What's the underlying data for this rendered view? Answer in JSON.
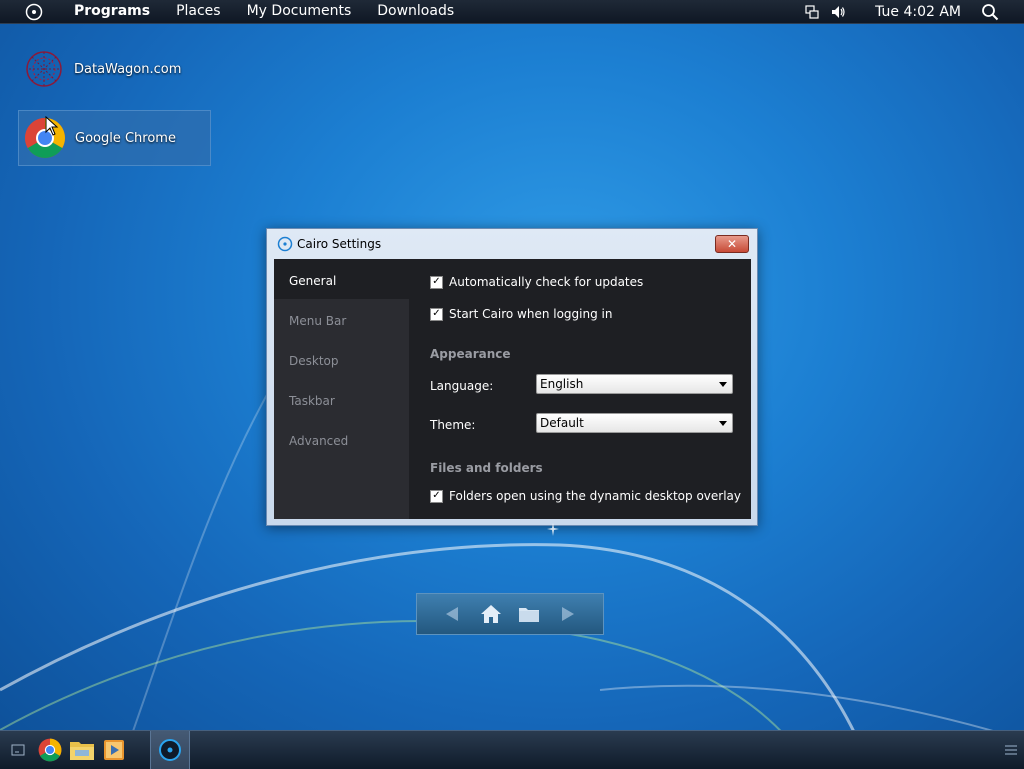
{
  "menubar": {
    "logo_icon": "cairo-logo-icon",
    "items": [
      {
        "label": "Programs"
      },
      {
        "label": "Places"
      },
      {
        "label": "My Documents"
      },
      {
        "label": "Downloads"
      }
    ],
    "clock": "Tue 4:02 AM"
  },
  "desktop": {
    "icons": [
      {
        "label": "DataWagon.com",
        "icon": "datawagon-icon"
      },
      {
        "label": "Google Chrome",
        "icon": "chrome-icon",
        "selected": true
      }
    ]
  },
  "window": {
    "title": "Cairo Settings",
    "nav": [
      {
        "label": "General",
        "active": true
      },
      {
        "label": "Menu Bar"
      },
      {
        "label": "Desktop"
      },
      {
        "label": "Taskbar"
      },
      {
        "label": "Advanced"
      }
    ],
    "general": {
      "auto_update": {
        "label": "Automatically check for updates",
        "checked": true
      },
      "start_login": {
        "label": "Start Cairo when logging in",
        "checked": true
      },
      "appearance_heading": "Appearance",
      "language_label": "Language:",
      "language_value": "English",
      "theme_label": "Theme:",
      "theme_value": "Default",
      "files_heading": "Files and folders",
      "folders_overlay": {
        "label": "Folders open using the dynamic desktop overlay",
        "checked": true
      }
    }
  },
  "colors": {
    "accent": "#1c7fd2",
    "menubar": "#1f2937",
    "window_content": "#1e1f23",
    "close_button": "#c74a36"
  }
}
